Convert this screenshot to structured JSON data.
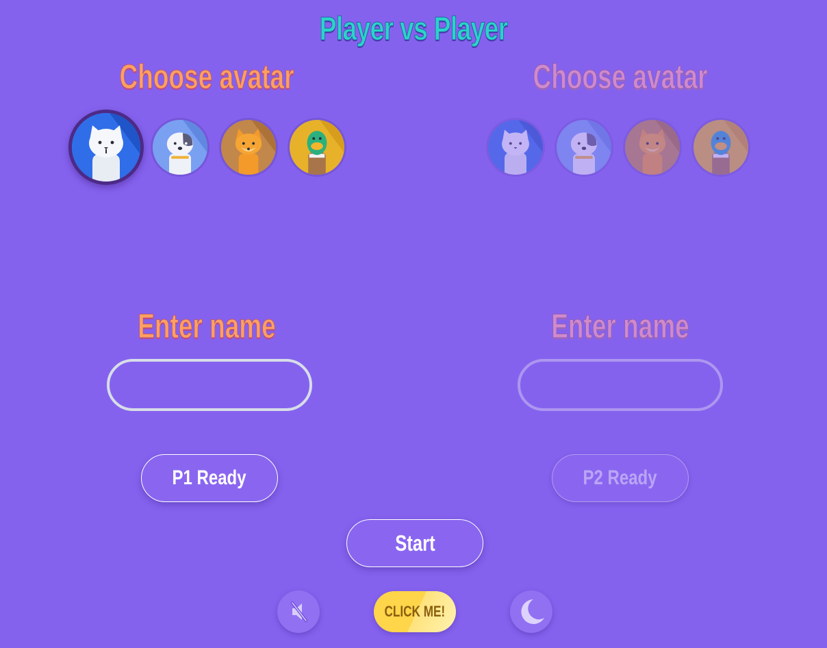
{
  "title": "Player vs Player",
  "players": [
    {
      "choose_avatar_label": "Choose avatar",
      "avatars": [
        "cat-avatar",
        "dog-avatar",
        "fox-avatar",
        "duck-avatar"
      ],
      "selected_avatar": "cat-avatar",
      "enter_name_label": "Enter name",
      "name_value": "",
      "ready_label": "P1 Ready"
    },
    {
      "choose_avatar_label": "Choose avatar",
      "avatars": [
        "cat-avatar",
        "dog-avatar",
        "fox-avatar",
        "duck-avatar"
      ],
      "selected_avatar": "",
      "enter_name_label": "Enter name",
      "name_value": "",
      "ready_label": "P2 Ready"
    }
  ],
  "start_label": "Start",
  "controls": {
    "mute_icon": "speaker-muted-icon",
    "click_me_label": "CLICK ME!",
    "theme_icon": "moon-icon"
  },
  "colors": {
    "background": "#8562ee",
    "title": "#2ad4c8",
    "heading_active": "#ffa060",
    "heading_inactive": "#d08acb",
    "click_me": "#ffd54a"
  }
}
